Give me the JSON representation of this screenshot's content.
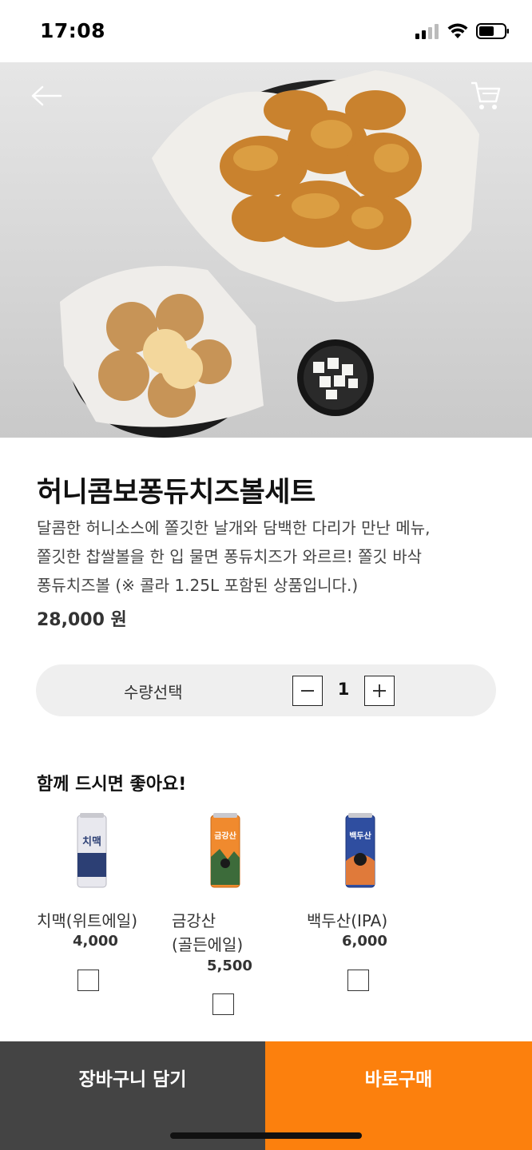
{
  "status_bar": {
    "time": "17:08"
  },
  "product": {
    "title": "허니콤보퐁듀치즈볼세트",
    "description_lines": [
      "달콤한 허니소스에 쫄깃한 날개와 담백한 다리가 만난 메뉴,",
      "쫄깃한 찹쌀볼을 한 입 물면 퐁듀치즈가 와르르! 쫄깃 바삭",
      "퐁듀치즈볼 (※ 콜라 1.25L 포함된 상품입니다.)"
    ],
    "price": "28,000 원"
  },
  "quantity": {
    "label": "수량선택",
    "value": "1"
  },
  "recommendations": {
    "title": "함께 드시면 좋아요!",
    "items": [
      {
        "name_lines": [
          "치맥(위트에일)"
        ],
        "price": "4,000",
        "can_label": "치맥",
        "can_color": "#e8e8ee",
        "checked": false
      },
      {
        "name_lines": [
          "금강산",
          "(골든에일)"
        ],
        "price": "5,500",
        "can_label": "금강산",
        "can_color": "#f08a2e",
        "checked": false
      },
      {
        "name_lines": [
          "백두산(IPA)"
        ],
        "price": "6,000",
        "can_label": "백두산",
        "can_color": "#2f4ea0",
        "checked": false
      }
    ]
  },
  "actions": {
    "add_to_cart": "장바구니 담기",
    "buy_now": "바로구매"
  },
  "colors": {
    "accent": "#fc800d",
    "dark_button": "#444444"
  },
  "icons": [
    "back-arrow-icon",
    "cart-icon",
    "minus-icon",
    "plus-icon"
  ]
}
